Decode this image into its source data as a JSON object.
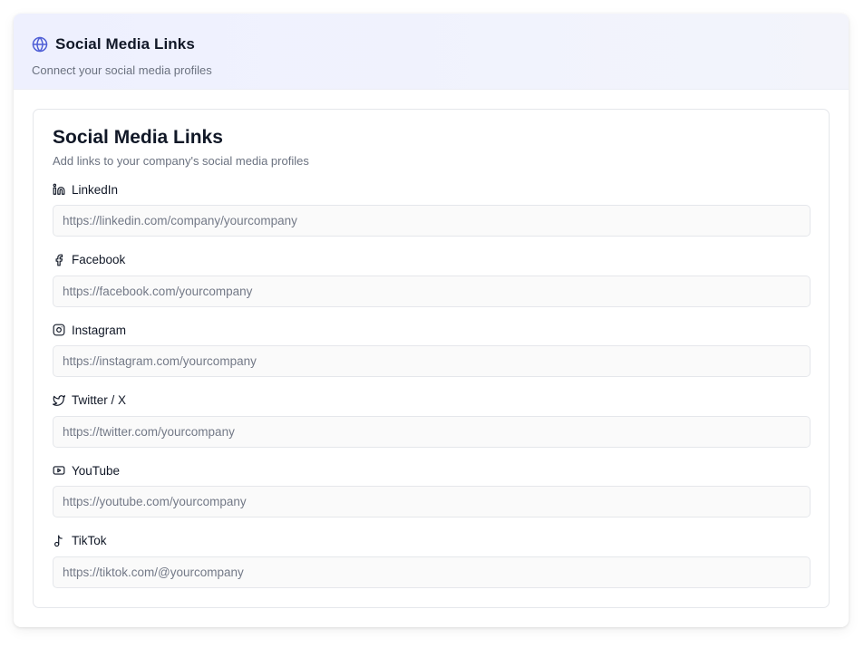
{
  "header": {
    "title": "Social Media Links",
    "subtitle": "Connect your social media profiles",
    "icon": "globe-icon",
    "accent_color": "#4f5fd6"
  },
  "section": {
    "title": "Social Media Links",
    "subtitle": "Add links to your company's social media profiles"
  },
  "fields": [
    {
      "label": "LinkedIn",
      "icon": "linkedin-icon",
      "value": "",
      "placeholder": "https://linkedin.com/company/yourcompany"
    },
    {
      "label": "Facebook",
      "icon": "facebook-icon",
      "value": "",
      "placeholder": "https://facebook.com/yourcompany"
    },
    {
      "label": "Instagram",
      "icon": "instagram-icon",
      "value": "",
      "placeholder": "https://instagram.com/yourcompany"
    },
    {
      "label": "Twitter / X",
      "icon": "twitter-icon",
      "value": "",
      "placeholder": "https://twitter.com/yourcompany"
    },
    {
      "label": "YouTube",
      "icon": "youtube-icon",
      "value": "",
      "placeholder": "https://youtube.com/yourcompany"
    },
    {
      "label": "TikTok",
      "icon": "tiktok-icon",
      "value": "",
      "placeholder": "https://tiktok.com/@yourcompany"
    }
  ]
}
